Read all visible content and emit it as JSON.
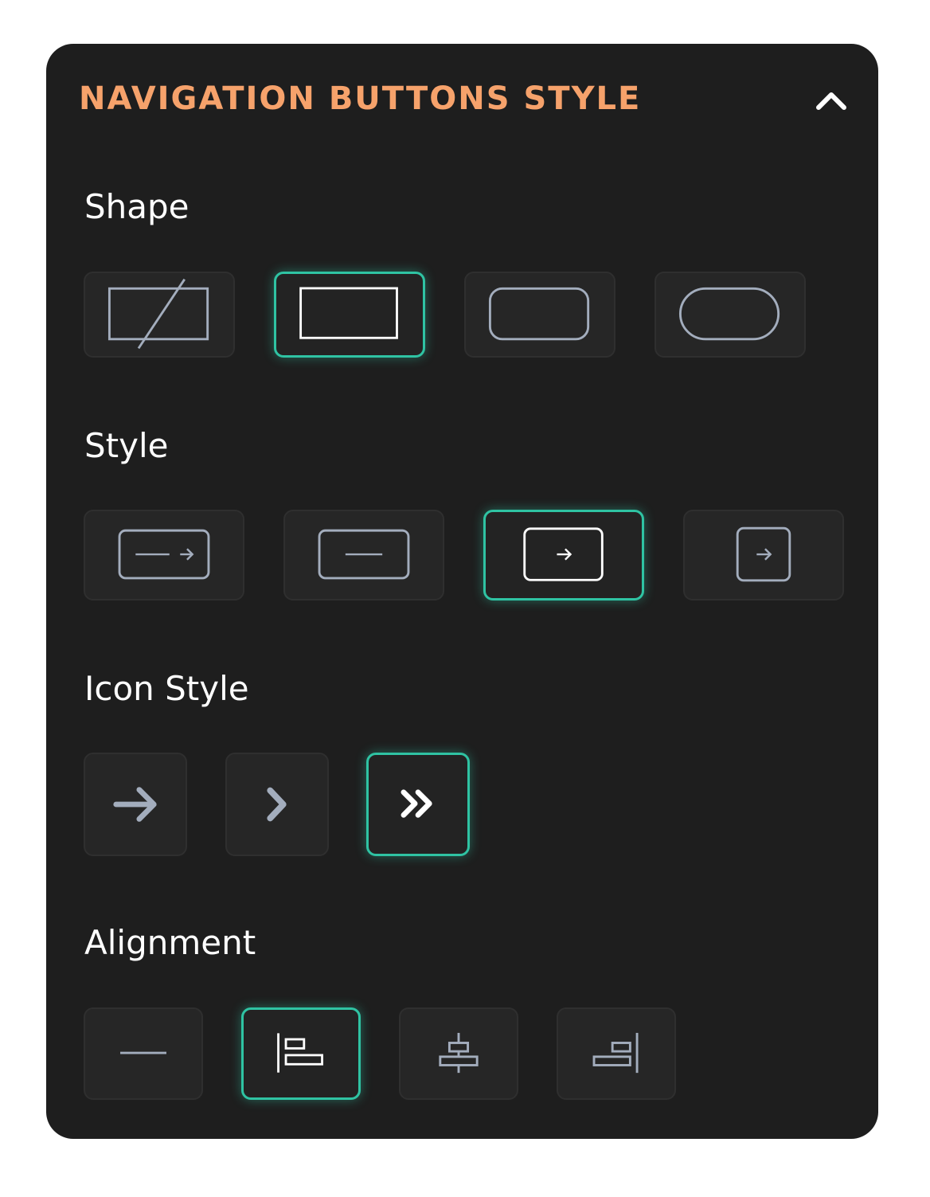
{
  "panel": {
    "title": "NAVIGATION BUTTONS STYLE",
    "collapse_icon": "chevron-up-icon"
  },
  "colors": {
    "title": "#f6a26b",
    "selected_border": "#2fc3a3",
    "panel_bg": "#1e1e1e",
    "option_bg": "#262626",
    "icon_default": "#a3adbd",
    "icon_selected": "#ffffff"
  },
  "sections": {
    "shape": {
      "label": "Shape",
      "options": [
        "shape-none-icon",
        "shape-square-icon",
        "shape-rounded-icon",
        "shape-pill-icon"
      ],
      "selected": "shape-square-icon"
    },
    "style": {
      "label": "Style",
      "options": [
        "style-text-and-icon-icon",
        "style-text-only-icon",
        "style-icon-box-icon",
        "style-icon-only-icon"
      ],
      "selected": "style-icon-box-icon"
    },
    "icon_style": {
      "label": "Icon Style",
      "options": [
        "arrow-right-icon",
        "chevron-right-icon",
        "double-chevron-right-icon"
      ],
      "selected": "double-chevron-right-icon"
    },
    "alignment": {
      "label": "Alignment",
      "options": [
        "align-none-icon",
        "align-left-icon",
        "align-center-icon",
        "align-right-icon"
      ],
      "selected": "align-left-icon"
    }
  }
}
